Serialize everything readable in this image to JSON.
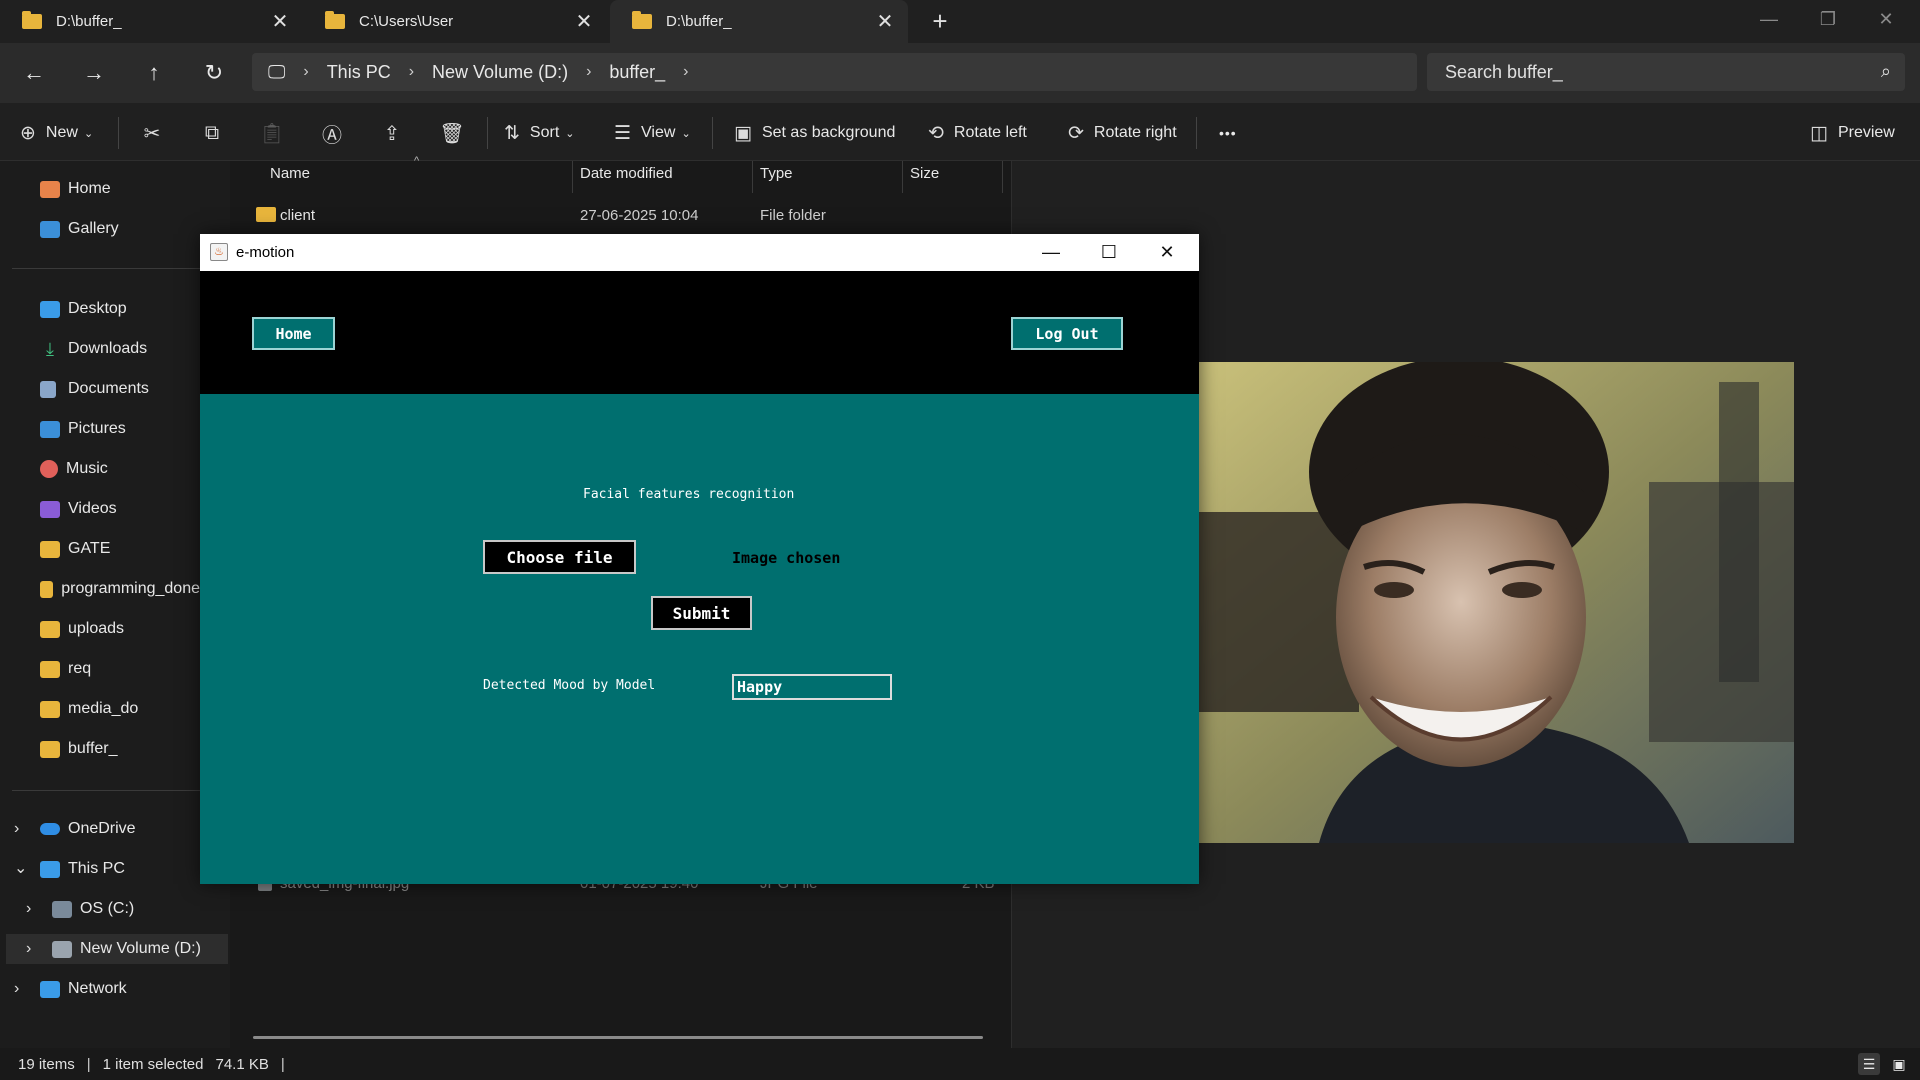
{
  "tabs": [
    {
      "label": "D:\\buffer_"
    },
    {
      "label": "C:\\Users\\User"
    },
    {
      "label": "D:\\buffer_"
    }
  ],
  "window_controls": {
    "minimize": "—",
    "restore": "❐",
    "close": "✕"
  },
  "breadcrumb": {
    "root": "This PC",
    "drive": "New Volume (D:)",
    "folder": "buffer_"
  },
  "search": {
    "placeholder": "Search buffer_"
  },
  "commands": {
    "new": "New",
    "sort": "Sort",
    "view": "View",
    "set_background": "Set as background",
    "rotate_left": "Rotate left",
    "rotate_right": "Rotate right",
    "more": "•••",
    "preview": "Preview"
  },
  "sidebar": {
    "home": "Home",
    "gallery": "Gallery",
    "desktop": "Desktop",
    "downloads": "Downloads",
    "documents": "Documents",
    "pictures": "Pictures",
    "music": "Music",
    "videos": "Videos",
    "gate": "GATE",
    "programming": "programming_done",
    "uploads": "uploads",
    "req": "req",
    "media": "media_do",
    "buffer": "buffer_",
    "onedrive": "OneDrive",
    "thispc": "This PC",
    "osc": "OS (C:)",
    "newvol": "New Volume (D:)",
    "network": "Network"
  },
  "columns": {
    "name": "Name",
    "date": "Date modified",
    "type": "Type",
    "size": "Size"
  },
  "files": [
    {
      "name": "client",
      "date": "27-06-2025 10:04",
      "type": "File folder",
      "size": ""
    },
    {
      "name": "saved_img-final.jpg",
      "date": "01-07-2025 19:40",
      "type": "JPG File",
      "size": "2 KB"
    }
  ],
  "status": {
    "items": "19 items",
    "selected": "1 item selected",
    "size": "74.1 KB"
  },
  "app": {
    "title": "e-motion",
    "home_button": "Home",
    "logout_button": "Log Out",
    "heading": "Facial features recognition",
    "choose_button": "Choose file",
    "chosen_text": "Image chosen",
    "submit_button": "Submit",
    "mood_label": "Detected Mood by Model",
    "mood_value": "Happy"
  },
  "colors": {
    "app_teal": "#006f6f",
    "folder": "#e8b53c",
    "explorer_bg": "#191919"
  }
}
